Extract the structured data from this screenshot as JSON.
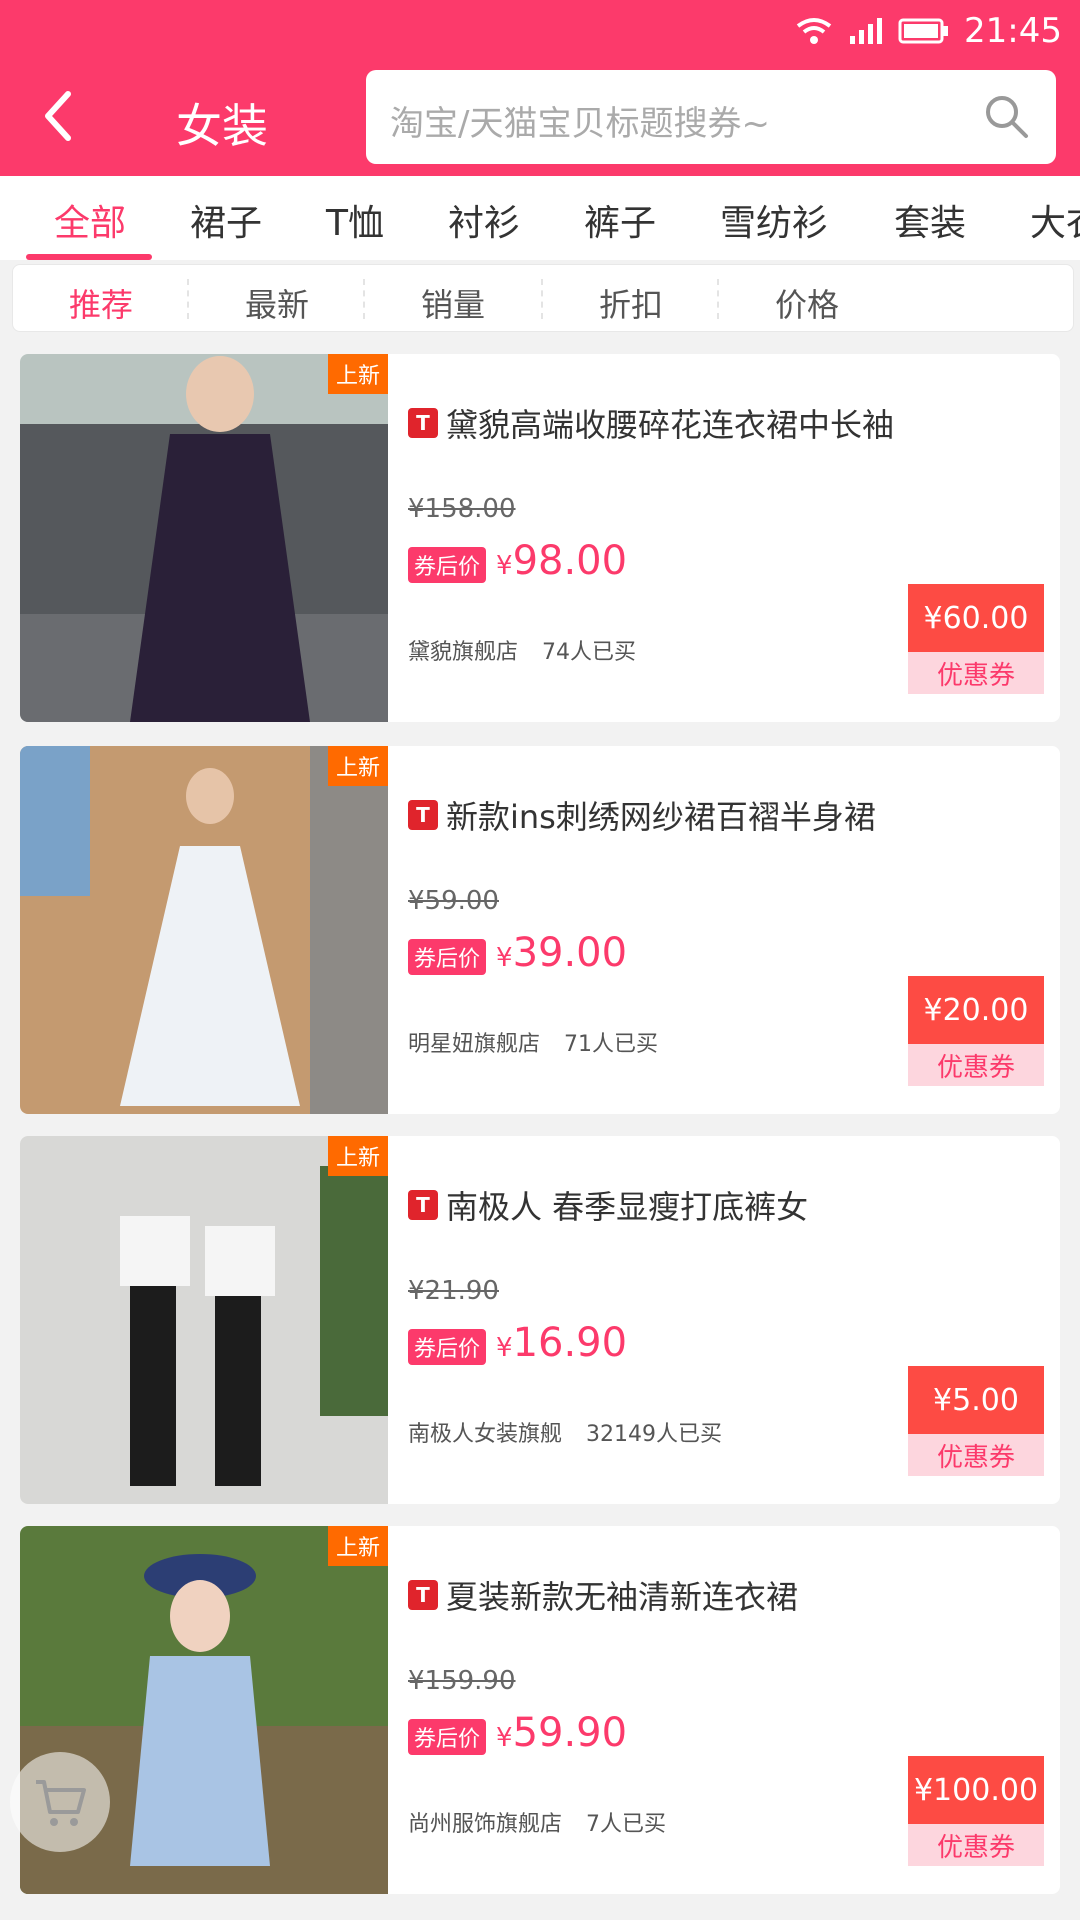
{
  "status": {
    "time": "21:45"
  },
  "header": {
    "title": "女装",
    "search_placeholder": "淘宝/天猫宝贝标题搜券~"
  },
  "tabs": [
    "全部",
    "裙子",
    "T恤",
    "衬衫",
    "裤子",
    "雪纺衫",
    "套装",
    "大衣"
  ],
  "sort": [
    "推荐",
    "最新",
    "销量",
    "折扣",
    "价格"
  ],
  "products": [
    {
      "badge": "上新",
      "title": "黛貌高端收腰碎花连衣裙中长袖",
      "orig": "¥158.00",
      "after_tag": "券后价",
      "yen": "¥",
      "price": "98.00",
      "store": "黛貌旗舰店",
      "sold": "74人已买",
      "coupon_value": "¥60.00",
      "coupon_label": "优惠券"
    },
    {
      "badge": "上新",
      "title": "新款ins刺绣网纱裙百褶半身裙",
      "orig": "¥59.00",
      "after_tag": "券后价",
      "yen": "¥",
      "price": "39.00",
      "store": "明星妞旗舰店",
      "sold": "71人已买",
      "coupon_value": "¥20.00",
      "coupon_label": "优惠券"
    },
    {
      "badge": "上新",
      "title": "南极人 春季显瘦打底裤女",
      "orig": "¥21.90",
      "after_tag": "券后价",
      "yen": "¥",
      "price": "16.90",
      "store": "南极人女装旗舰",
      "sold": "32149人已买",
      "coupon_value": "¥5.00",
      "coupon_label": "优惠券"
    },
    {
      "badge": "上新",
      "title": "夏装新款无袖清新连衣裙",
      "orig": "¥159.90",
      "after_tag": "券后价",
      "yen": "¥",
      "price": "59.90",
      "store": "尚州服饰旗舰店",
      "sold": "7人已买",
      "coupon_value": "¥100.00",
      "coupon_label": "优惠券"
    }
  ]
}
